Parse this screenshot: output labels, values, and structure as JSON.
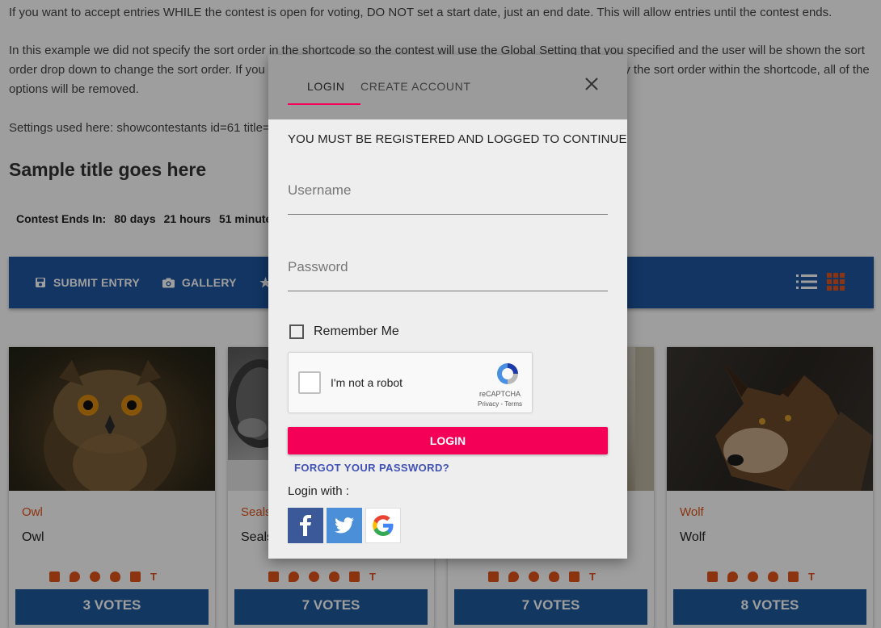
{
  "page": {
    "para1": "If you want to accept entries WHILE the contest is open for voting, DO NOT set a start date, just an end date. This will allow entries until the contest ends.",
    "para2": "In this example we did not specify the sort order in the shortcode so the contest will use the Global Setting that you specified and the user will be shown the sort order drop down to change the sort order. If you specify the sort order it will automatically be removed. If you specify the sort order within the shortcode, all of the options will be removed.",
    "para3": "Settings used here: showcontestants id=61 title=",
    "title": "Sample title goes here",
    "countdown": {
      "label": "Contest Ends In:",
      "days": "80 days",
      "hours": "21 hours",
      "minutes": "51 minutes"
    }
  },
  "toolbar": {
    "submit_label": "SUBMIT ENTRY",
    "gallery_label": "GALLERY",
    "accent": "#1e56a0"
  },
  "cards": [
    {
      "category": "Owl",
      "name": "Owl",
      "votes": "3 VOTES"
    },
    {
      "category": "Seals",
      "name": "Seals",
      "votes": "7 VOTES"
    },
    {
      "category": "",
      "name": "",
      "votes": "7 VOTES"
    },
    {
      "category": "Wolf",
      "name": "Wolf",
      "votes": "8 VOTES"
    }
  ],
  "modal": {
    "tab_login": "LOGIN",
    "tab_create": "CREATE ACCOUNT",
    "must_text": "YOU MUST BE REGISTERED AND LOGGED TO CONTINUE",
    "username_placeholder": "Username",
    "password_placeholder": "Password",
    "remember_label": "Remember Me",
    "captcha_text": "I'm not a robot",
    "captcha_brand": "reCAPTCHA",
    "captcha_terms": "Privacy - Terms",
    "login_button": "LOGIN",
    "forgot_link": "FORGOT YOUR PASSWORD?",
    "login_with": "Login with :",
    "primary_color": "#f50057"
  }
}
